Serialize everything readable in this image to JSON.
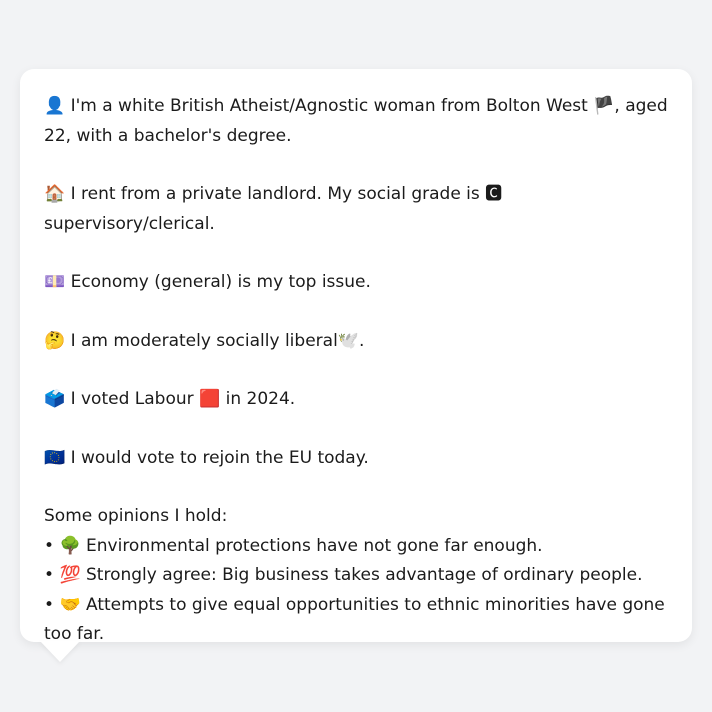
{
  "profile": {
    "identity": {
      "icon": "👤",
      "text_before_flag": " I'm a white British Atheist/Agnostic woman from Bolton West ",
      "flag": "🏴",
      "text_after_flag": ", aged 22, with a bachelor's degree."
    },
    "housing": {
      "icon": "🏠",
      "text_before_grade": " I rent from a private landlord. My social grade is ",
      "grade_icon": "🅲",
      "text_after_grade": " supervisory/clerical."
    },
    "issue": {
      "icon": "💷",
      "text": " Economy (general) is my top issue."
    },
    "social": {
      "icon": "🤔",
      "text": " I am moderately socially liberal",
      "end_icon": "🕊️",
      "end_text": "."
    },
    "vote": {
      "icon": "🗳️",
      "text_before_party": " I voted Labour ",
      "party_icon": "🟥",
      "text_after_party": " in 2024."
    },
    "eu": {
      "icon": "🇪🇺",
      "text": " I would vote to rejoin the EU today."
    }
  },
  "opinions": {
    "heading": "Some opinions I hold:",
    "items": [
      {
        "bullet": "•",
        "icon": "🌳",
        "text": " Environmental protections have not gone far enough."
      },
      {
        "bullet": "•",
        "icon": "💯",
        "text": " Strongly agree: Big business takes advantage of ordinary people."
      },
      {
        "bullet": "•",
        "icon": "🤝",
        "text": " Attempts to give equal opportunities to ethnic minorities have gone too far."
      }
    ]
  }
}
